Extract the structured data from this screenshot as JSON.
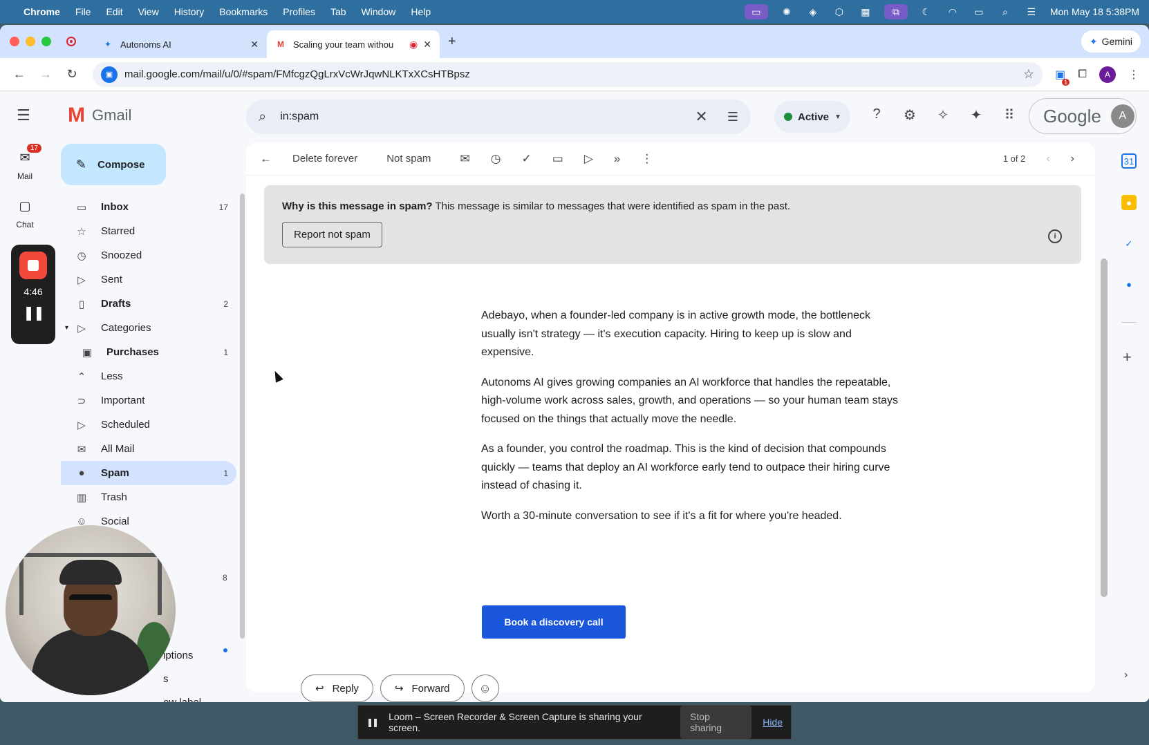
{
  "menubar": {
    "app": "Chrome",
    "items": [
      "File",
      "Edit",
      "View",
      "History",
      "Bookmarks",
      "Profiles",
      "Tab",
      "Window",
      "Help"
    ],
    "datetime": "Mon May 18  5:38PM"
  },
  "tabs": [
    {
      "title": "Autonoms AI"
    },
    {
      "title": "Scaling your team withou"
    }
  ],
  "gemini_label": "Gemini",
  "address": {
    "url": "mail.google.com/mail/u/0/#spam/FMfcgzQgLrxVcWrJqwNLKTxXCsHTBpsz"
  },
  "profile_initial": "A",
  "ext_badge": "1",
  "gmail": {
    "product_name": "Gmail",
    "compose_label": "Compose",
    "rail": {
      "mail_label": "Mail",
      "mail_badge": "17",
      "chat_label": "Chat",
      "loom_timer": "4:46"
    },
    "nav": [
      {
        "label": "Inbox",
        "count": "17"
      },
      {
        "label": "Starred",
        "count": ""
      },
      {
        "label": "Snoozed",
        "count": ""
      },
      {
        "label": "Sent",
        "count": ""
      },
      {
        "label": "Drafts",
        "count": "2"
      },
      {
        "label": "Categories",
        "count": ""
      },
      {
        "label": "Purchases",
        "count": "1"
      },
      {
        "label": "Less",
        "count": ""
      },
      {
        "label": "Important",
        "count": ""
      },
      {
        "label": "Scheduled",
        "count": ""
      },
      {
        "label": "All Mail",
        "count": ""
      },
      {
        "label": "Spam",
        "count": "1"
      },
      {
        "label": "Trash",
        "count": ""
      },
      {
        "label": "Social",
        "count": ""
      }
    ],
    "partial_count": "8",
    "partial_labels": [
      "iptions",
      "s",
      "ew label"
    ],
    "search": {
      "value": "in:spam"
    },
    "status": {
      "label": "Active"
    },
    "account_brand": "Google",
    "account_initial": "A",
    "toolbar": {
      "delete_forever": "Delete forever",
      "not_spam": "Not spam",
      "pager": "1 of 2"
    },
    "spam_banner": {
      "question": "Why is this message in spam?",
      "explanation": " This message is similar to messages that were identified as spam in the past.",
      "button": "Report not spam"
    },
    "message": {
      "paragraphs": [
        "Adebayo, when a founder-led company is in active growth mode, the bottleneck usually isn't strategy — it's execution capacity. Hiring to keep up is slow and expensive.",
        "Autonoms AI gives growing companies an AI workforce that handles the repeatable, high-volume work across sales, growth, and operations — so your human team stays focused on the things that actually move the needle.",
        "As a founder, you control the roadmap. This is the kind of decision that compounds quickly — teams that deploy an AI workforce early tend to outpace their hiring curve instead of chasing it.",
        "Worth a 30-minute conversation to see if it's a fit for where you're headed."
      ],
      "cta": "Book a discovery call"
    },
    "reply_label": "Reply",
    "forward_label": "Forward"
  },
  "sharebar": {
    "text": "Loom – Screen Recorder & Screen Capture is sharing your screen.",
    "stop": "Stop sharing",
    "hide": "Hide"
  }
}
